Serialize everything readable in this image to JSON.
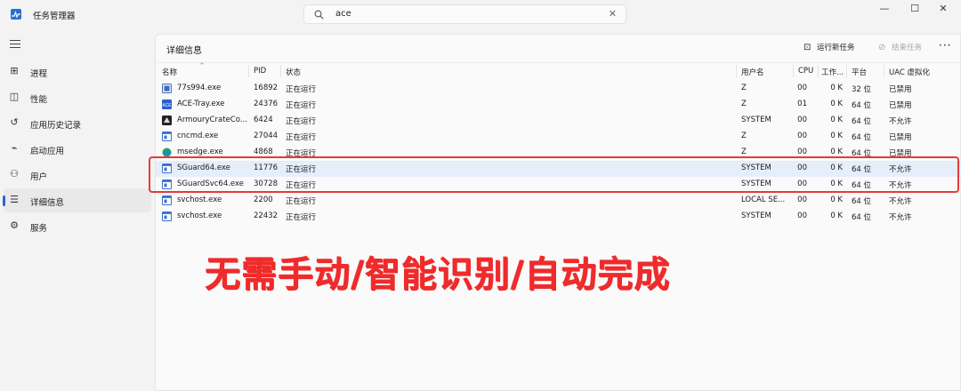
{
  "app": {
    "title": "任务管理器"
  },
  "search": {
    "value": "ace",
    "clear_glyph": "✕"
  },
  "window_controls": {
    "minimize": "—",
    "maximize": "☐",
    "close": "✕"
  },
  "sidebar": {
    "items": [
      {
        "label": "进程",
        "icon": "processes-icon",
        "glyph": "⊞"
      },
      {
        "label": "性能",
        "icon": "performance-icon",
        "glyph": "◫"
      },
      {
        "label": "应用历史记录",
        "icon": "history-icon",
        "glyph": "↺"
      },
      {
        "label": "启动应用",
        "icon": "startup-icon",
        "glyph": "⌁"
      },
      {
        "label": "用户",
        "icon": "users-icon",
        "glyph": "⚇"
      },
      {
        "label": "详细信息",
        "icon": "details-icon",
        "glyph": "☰",
        "active": true
      },
      {
        "label": "服务",
        "icon": "services-icon",
        "glyph": "⚙"
      }
    ]
  },
  "panel": {
    "title": "详细信息",
    "run_task": "运行新任务",
    "end_task": "结束任务",
    "more": "···"
  },
  "table": {
    "columns": [
      "名称",
      "PID",
      "状态",
      "用户名",
      "CPU",
      "工作...",
      "平台",
      "UAC 虚拟化"
    ],
    "rows": [
      {
        "name": "77s994.exe",
        "pid": "16892",
        "status": "正在运行",
        "user": "Z",
        "cpu": "00",
        "mem": "0 K",
        "platform": "32 位",
        "uac": "已禁用",
        "icon": "app-icon-generic"
      },
      {
        "name": "ACE-Tray.exe",
        "pid": "24376",
        "status": "正在运行",
        "user": "Z",
        "cpu": "01",
        "mem": "0 K",
        "platform": "64 位",
        "uac": "已禁用",
        "icon": "ace-tray-icon"
      },
      {
        "name": "ArmouryCrateCo...",
        "pid": "6424",
        "status": "正在运行",
        "user": "SYSTEM",
        "cpu": "00",
        "mem": "0 K",
        "platform": "64 位",
        "uac": "不允许",
        "icon": "armoury-crate-icon"
      },
      {
        "name": "cncmd.exe",
        "pid": "27044",
        "status": "正在运行",
        "user": "Z",
        "cpu": "00",
        "mem": "0 K",
        "platform": "64 位",
        "uac": "已禁用",
        "icon": "window-exe-icon"
      },
      {
        "name": "msedge.exe",
        "pid": "4868",
        "status": "正在运行",
        "user": "Z",
        "cpu": "00",
        "mem": "0 K",
        "platform": "64 位",
        "uac": "已禁用",
        "icon": "edge-icon"
      },
      {
        "name": "SGuard64.exe",
        "pid": "11776",
        "status": "正在运行",
        "user": "SYSTEM",
        "cpu": "00",
        "mem": "0 K",
        "platform": "64 位",
        "uac": "不允许",
        "icon": "window-exe-icon",
        "selected": true
      },
      {
        "name": "SGuardSvc64.exe",
        "pid": "30728",
        "status": "正在运行",
        "user": "SYSTEM",
        "cpu": "00",
        "mem": "0 K",
        "platform": "64 位",
        "uac": "不允许",
        "icon": "window-exe-icon"
      },
      {
        "name": "svchost.exe",
        "pid": "2200",
        "status": "正在运行",
        "user": "LOCAL SE...",
        "cpu": "00",
        "mem": "0 K",
        "platform": "64 位",
        "uac": "不允许",
        "icon": "window-exe-icon"
      },
      {
        "name": "svchost.exe",
        "pid": "22432",
        "status": "正在运行",
        "user": "SYSTEM",
        "cpu": "00",
        "mem": "0 K",
        "platform": "64 位",
        "uac": "不允许",
        "icon": "window-exe-icon"
      }
    ]
  },
  "overlay": {
    "text": "无需手动/智能识别/自动完成"
  },
  "colors": {
    "accent": "#2e64c7",
    "highlight": "#e33b3b",
    "overlay": "#ef2b2b",
    "selected_row": "#e5eefb"
  }
}
